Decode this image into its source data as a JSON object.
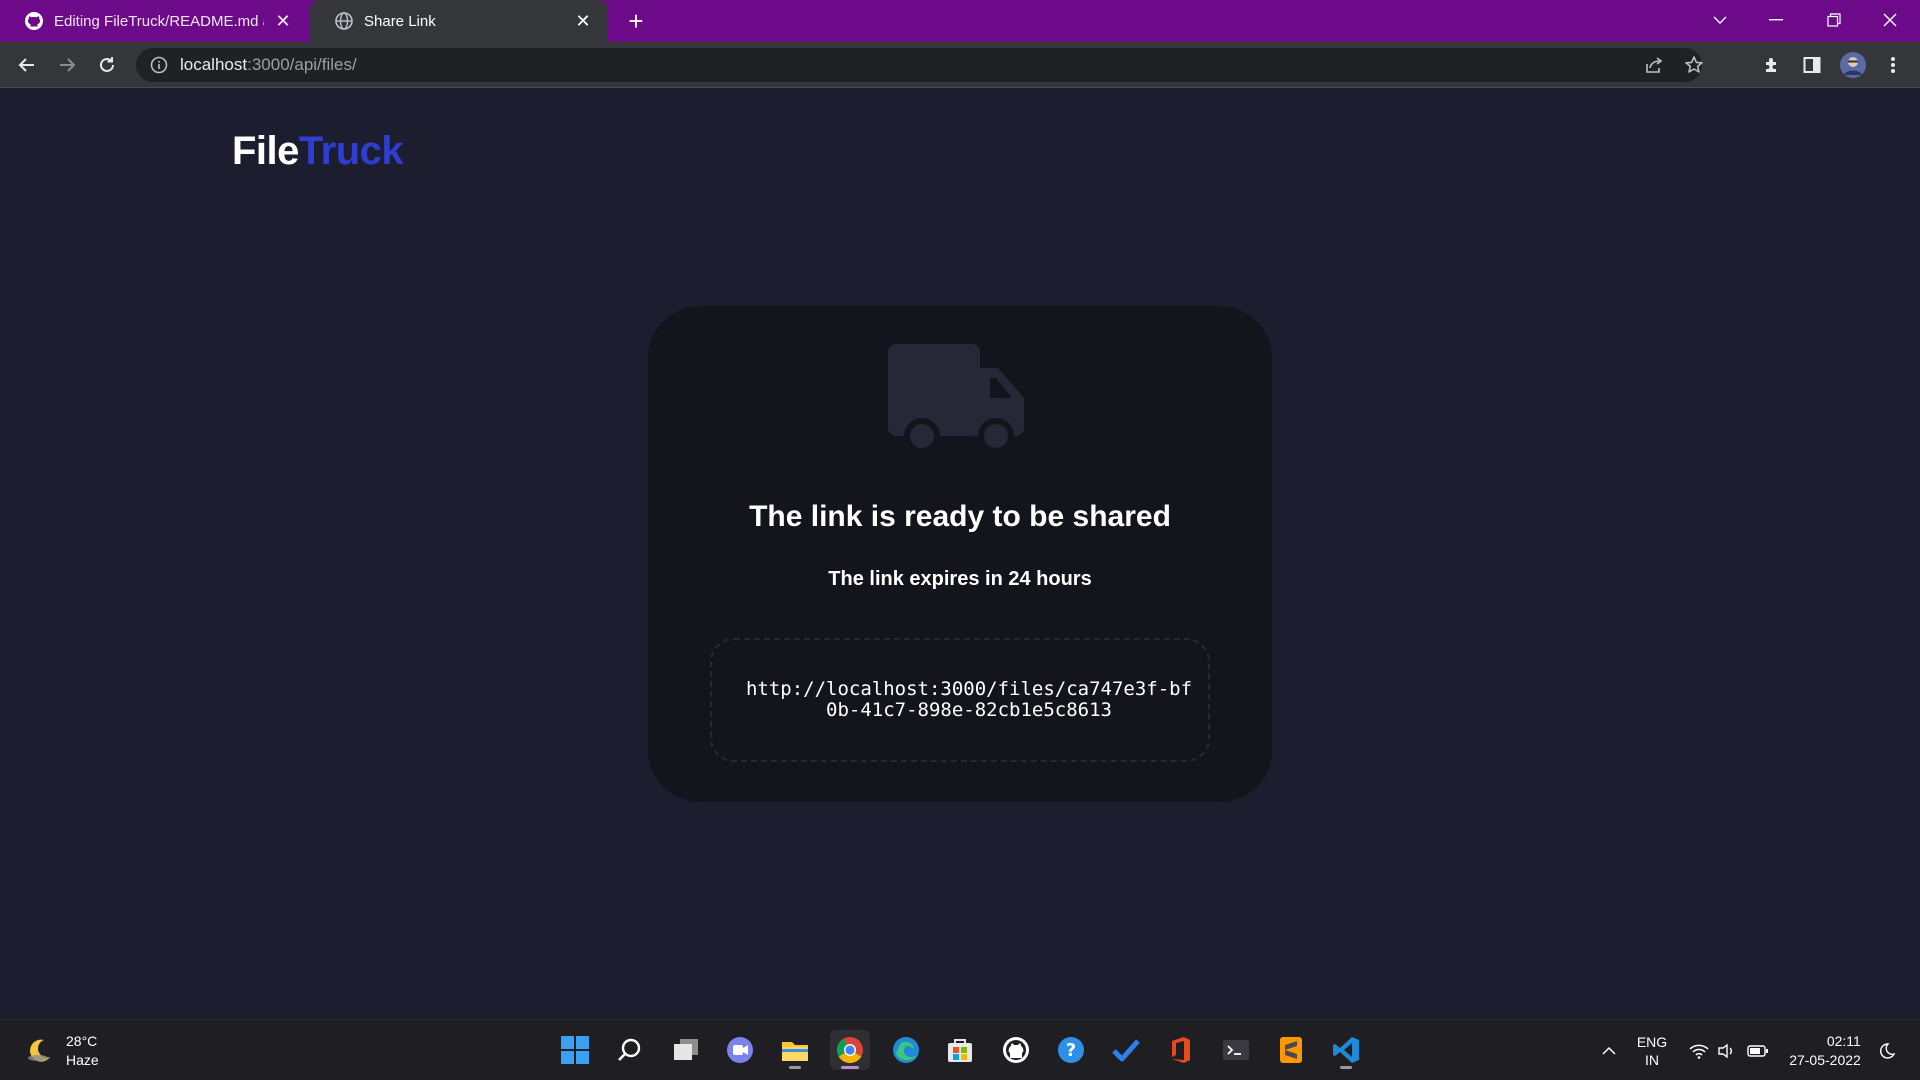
{
  "browser": {
    "tabs": [
      {
        "title": "Editing FileTruck/README.md at",
        "icon": "github-icon"
      },
      {
        "title": "Share Link",
        "icon": "globe-icon"
      }
    ],
    "new_tab_label": "+",
    "url_host": "localhost",
    "url_path": ":3000/api/files/"
  },
  "page": {
    "logo_part1": "File",
    "logo_part2": "Truck",
    "card": {
      "icon": "truck-icon",
      "title": "The link is ready to be shared",
      "subtitle": "The link expires in 24 hours",
      "link": "http://localhost:3000/files/ca747e3f-bf0b-41c7-898e-82cb1e5c8613"
    }
  },
  "taskbar": {
    "weather_temp": "28°C",
    "weather_desc": "Haze",
    "lang_1": "ENG",
    "lang_2": "IN",
    "time": "02:11",
    "date": "27-05-2022"
  },
  "colors": {
    "tabstrip": "#6c0a8a",
    "page_bg": "#1c1e30",
    "card_bg": "#14151c",
    "logo_accent": "#2f3ed0"
  }
}
